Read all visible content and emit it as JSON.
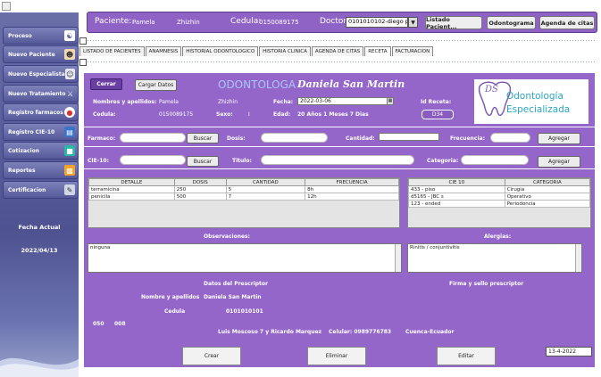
{
  "sidebar": {
    "items": [
      {
        "label": "Proceso",
        "icon": "teeth-icon"
      },
      {
        "label": "Nuevo Paciente",
        "icon": "patient-icon"
      },
      {
        "label": "Nuevo Especialista",
        "icon": "doctor-icon"
      },
      {
        "label": "Nuevo Tratamiento",
        "icon": "tools-icon"
      },
      {
        "label": "Registro farmacos",
        "icon": "pill-icon"
      },
      {
        "label": "Registro CIE-10",
        "icon": "book-icon"
      },
      {
        "label": "Cotizacion",
        "icon": "cart-icon"
      },
      {
        "label": "Reportes",
        "icon": "chart-icon"
      },
      {
        "label": "Certificacion",
        "icon": "certificate-icon"
      }
    ],
    "date_label": "Fecha Actual",
    "date_value": "2022/04/13"
  },
  "header": {
    "paciente_label": "Paciente:",
    "paciente_value": "Pamela",
    "paciente_apellido": "Zhizhin",
    "cedula_label": "Cedula:",
    "cedula_value": "0150089175",
    "doctor_label": "Doctor",
    "doctor_value": "0101010102-diego pa...",
    "buttons": {
      "listado": "Listado Pacient...",
      "odontograma": "Odontograma",
      "agenda": "Agenda de citas"
    }
  },
  "tabs": [
    {
      "label": "LISTADO DE PACIENTES"
    },
    {
      "label": "ANAMNESIS"
    },
    {
      "label": "HISTORIAL ODONTOLOGICO"
    },
    {
      "label": "HISTORIA CLINICA"
    },
    {
      "label": "AGENDA DE CITAS"
    },
    {
      "label": "RECETA"
    },
    {
      "label": "FACTURACION"
    }
  ],
  "receta": {
    "cerrar": "Cerrar",
    "cargar": "Cargar Datos",
    "title": "ODONTOLOGA",
    "doctor_name": "Daniela San Martin",
    "nombres_label": "Nombres y apellidos:",
    "nombre": "Pamela",
    "apellido": "Zhizhin",
    "fecha_label": "Fecha:",
    "fecha_value": "2022-03-06",
    "idreceta_label": "Id Receta:",
    "idreceta_value": "D34",
    "cedula_label": "Cedula:",
    "cedula_value": "0150089175",
    "sexo_label": "Sexo:",
    "sexo_value": "I",
    "edad_label": "Edad:",
    "edad_value": "20 Años 1 Meses 7 Dias",
    "logo_initials": "DS",
    "logo_line1": "Odontología",
    "logo_line2": "Especializada",
    "farmaco_label": "Farmaco:",
    "buscar": "Buscar",
    "dosis_label": "Dosis:",
    "cantidad_label": "Cantidad:",
    "frecuencia_label": "Frecuencia:",
    "agregar": "Agregar",
    "cie_label": "CIE-10:",
    "titulo_label": "Titulo:",
    "categoria_label": "Categoria:",
    "drug_table": {
      "columns": [
        "DETALLE",
        "DOSIS",
        "CANTIDAD",
        "FRECUENCIA"
      ],
      "rows": [
        [
          "terramicina",
          "250",
          "5",
          "8h"
        ],
        [
          "penicila",
          "500",
          "7",
          "12h"
        ]
      ]
    },
    "cie_table": {
      "columns": [
        "CIE 10",
        "CATEGORIA"
      ],
      "rows": [
        [
          "433 - piso",
          "Cirugia"
        ],
        [
          "d5165 - JBC s",
          "Operativo"
        ],
        [
          "123 - ended",
          "Periodoncia"
        ]
      ]
    },
    "observaciones_label": "Observaciones:",
    "observaciones_value": "ninguna",
    "alergias_label": "Alergias:",
    "alergias_value": "Rinitis / conjuntivitis",
    "prescriptor_title": "Datos  del Prescriptor",
    "presc_nombres_label": "Nombre y apellidos",
    "presc_nombre": "Daniela   San  Martin",
    "presc_cedula_label": "Cedula",
    "presc_cedula": "0101010101",
    "firma_label": "Firma y sello prescriptor",
    "codes_a": "050",
    "codes_b": "008",
    "address": "Luis Moscoso 7 y Ricardo Marquez",
    "celular": "Celular: 0989776783",
    "ciudad": "Cuenca-Ecuador"
  },
  "actions": {
    "crear": "Crear",
    "eliminar": "Eliminar",
    "editar": "Editar",
    "date": "13-4-2022"
  },
  "colors": {
    "panel": "#9466c9",
    "sidebar": "#5b5f9c",
    "title_blue": "#a9c6ff",
    "logo_teal": "#2aa5c0"
  }
}
